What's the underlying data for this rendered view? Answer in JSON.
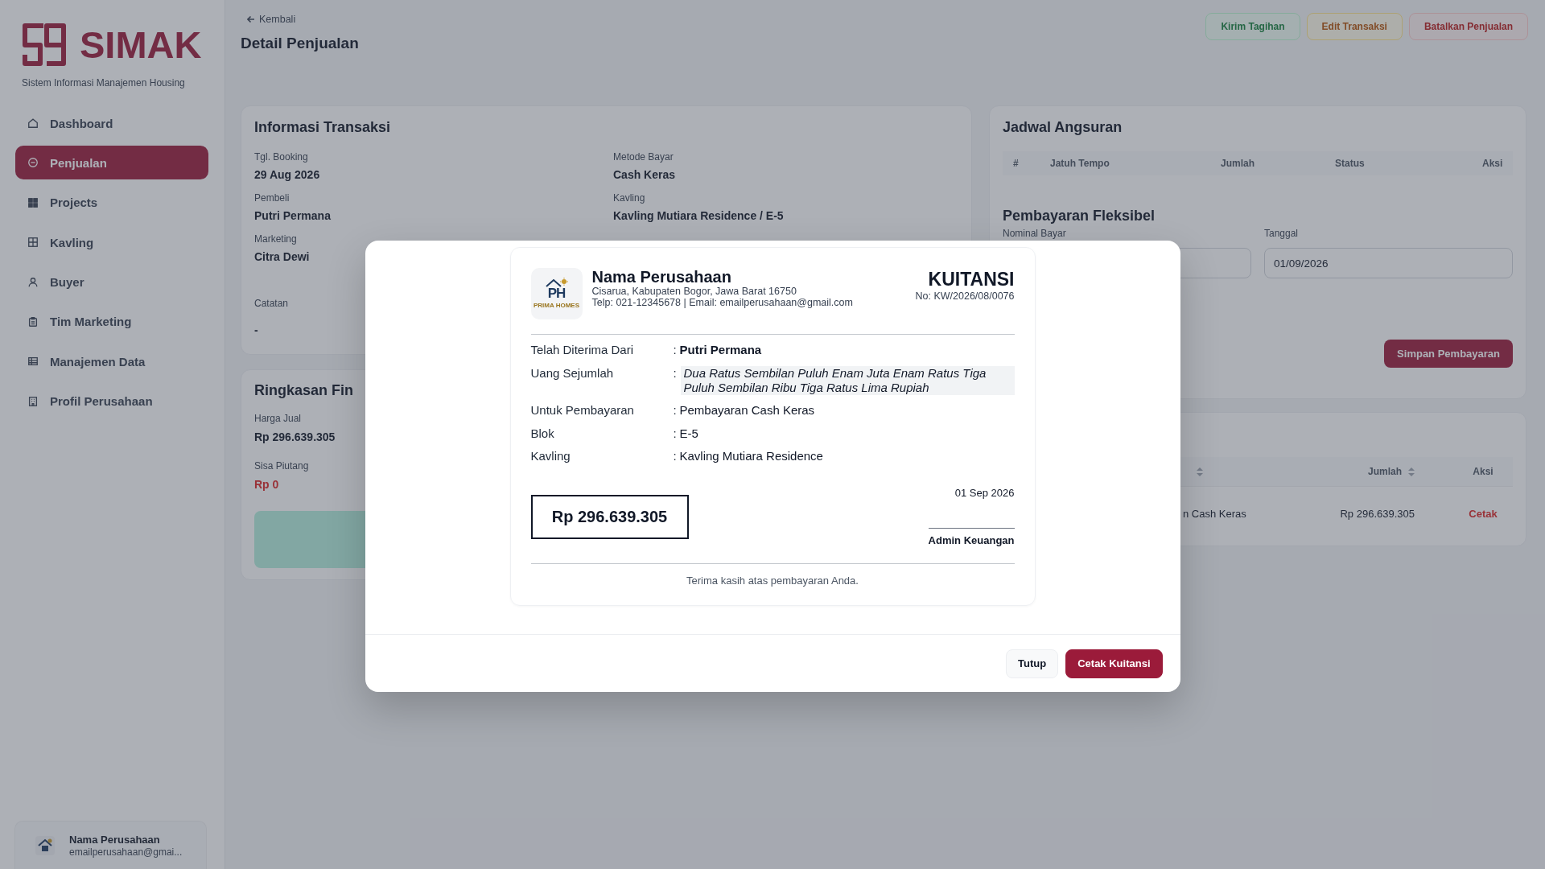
{
  "sidebar": {
    "brand": {
      "name": "SIMAK",
      "tagline": "Sistem Informasi Manajemen Housing"
    },
    "items": [
      {
        "label": "Dashboard",
        "selected": false
      },
      {
        "label": "Penjualan",
        "selected": true
      },
      {
        "label": "Projects",
        "selected": false
      },
      {
        "label": "Kavling",
        "selected": false
      },
      {
        "label": "Buyer",
        "selected": false
      },
      {
        "label": "Tim Marketing",
        "selected": false
      },
      {
        "label": "Manajemen Data",
        "selected": false
      },
      {
        "label": "Profil Perusahaan",
        "selected": false
      }
    ],
    "account": {
      "name": "Nama Perusahaan",
      "email": "emailperusahaan@gmai..."
    }
  },
  "page_header": {
    "back_link": "Kembali",
    "title": "Detail Penjualan",
    "actions": [
      {
        "label": "Kirim Tagihan",
        "kind": "success"
      },
      {
        "label": "Edit Transaksi",
        "kind": "warning"
      },
      {
        "label": "Batalkan Penjualan",
        "kind": "danger"
      }
    ]
  },
  "transaction_info": {
    "title": "Informasi Transaksi",
    "fields": [
      {
        "label": "Tgl. Booking",
        "value": "29 Aug 2026"
      },
      {
        "label": "Metode Bayar",
        "value": "Cash Keras"
      },
      {
        "label": "Pembeli",
        "value": "Putri Permana"
      },
      {
        "label": "Kavling",
        "value": "Kavling Mutiara Residence / E-5"
      },
      {
        "label": "Marketing",
        "value": "Citra Dewi"
      }
    ],
    "note": {
      "label": "Catatan",
      "value": "-"
    }
  },
  "financial_summary": {
    "title": "Ringkasan Fin",
    "fields": [
      {
        "label": "Harga Jual",
        "value": "Rp 296.639.305",
        "kind": "amount"
      },
      {
        "label": "Sisa Piutang",
        "value": "Rp 0",
        "kind": "outstanding"
      }
    ]
  },
  "installment_schedule": {
    "title": "Jadwal Angsuran",
    "columns": [
      "#",
      "Jatuh Tempo",
      "Jumlah",
      "Status",
      "Aksi"
    ],
    "flexible_payment": {
      "title": "Pembayaran Fleksibel",
      "amount_label": "Nominal Bayar",
      "date_label": "Tanggal",
      "date_value": "01/09/2026",
      "submit_button": "Simpan Pembayaran"
    }
  },
  "payment_history": {
    "columns": [
      {
        "sortable": true
      },
      {
        "label": "Jumlah",
        "sortable": true
      },
      {
        "label": "Aksi",
        "sortable": false
      }
    ],
    "rows": [
      {
        "description": "n Cash Keras",
        "amount": "Rp 296.639.305",
        "action": "Cetak"
      }
    ]
  },
  "receipt_modal": {
    "company": {
      "logo_monogram": "PH",
      "logo_wordmark": "PRIMA HOMES",
      "name": "Nama Perusahaan",
      "address": "Cisarua, Kabupaten Bogor, Jawa Barat 16750",
      "contact": "Telp: 021-12345678 | Email: emailperusahaan@gmail.com"
    },
    "title": "KUITANSI",
    "number": "No: KW/2026/08/0076",
    "rows": [
      {
        "label": "Telah Diterima Dari",
        "separator": ":",
        "value": "Putri Permana",
        "kind": "name"
      },
      {
        "label": "Uang Sejumlah",
        "separator": ":",
        "value": "Dua Ratus Sembilan Puluh Enam Juta Enam Ratus Tiga Puluh Sembilan Ribu Tiga Ratus Lima Rupiah",
        "kind": "spelled"
      },
      {
        "label": "Untuk Pembayaran",
        "separator": ":",
        "value": "Pembayaran Cash Keras",
        "kind": "plain"
      },
      {
        "label": "Blok",
        "separator": ":",
        "value": "E-5",
        "kind": "plain"
      },
      {
        "label": "Kavling",
        "separator": ":",
        "value": "Kavling Mutiara Residence",
        "kind": "plain"
      }
    ],
    "amount": "Rp 296.639.305",
    "date": "01 Sep 2026",
    "signatory": "Admin Keuangan",
    "footer_note": "Terima kasih atas pembayaran Anda.",
    "buttons": [
      {
        "label": "Tutup",
        "kind": "secondary"
      },
      {
        "label": "Cetak Kuitansi",
        "kind": "primary"
      }
    ]
  }
}
